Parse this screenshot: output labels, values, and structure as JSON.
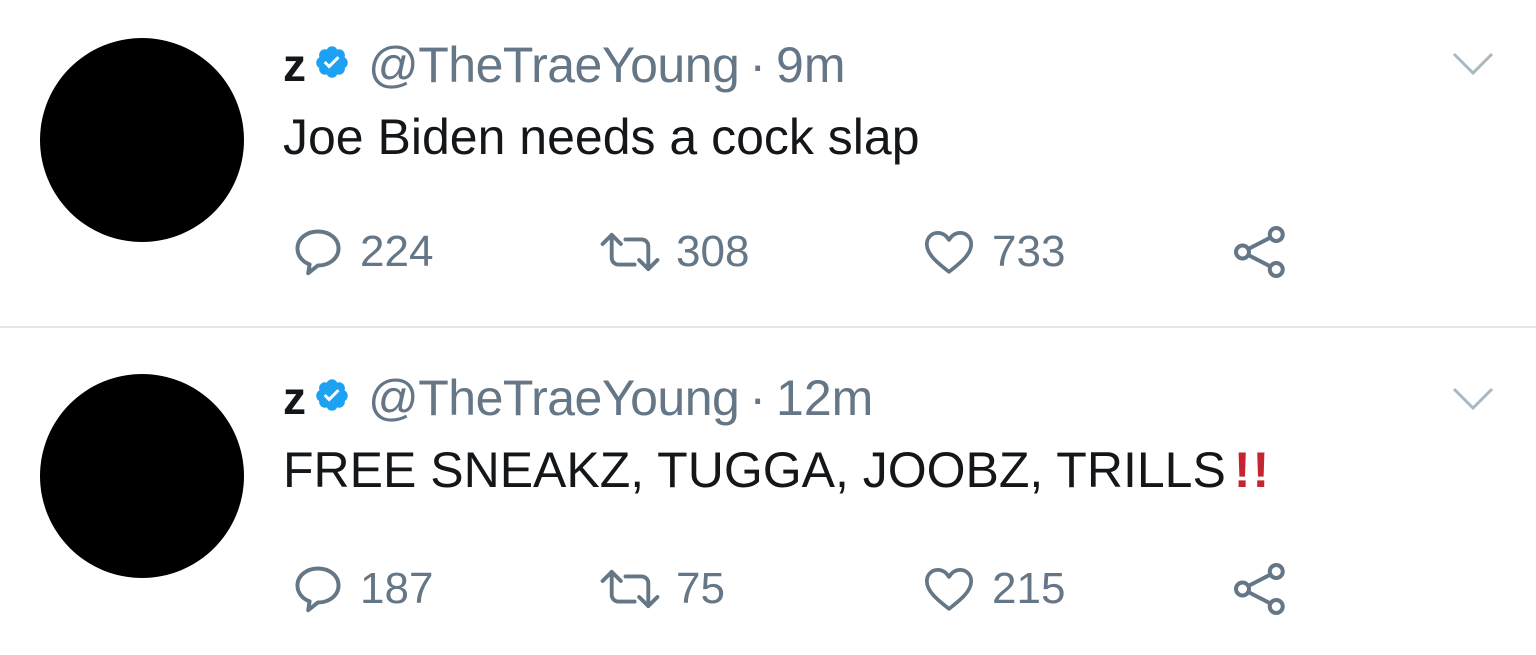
{
  "tweets": [
    {
      "name": "z",
      "handle": "@TheTraeYoung",
      "separator": "·",
      "time": "9m",
      "text": "Joe Biden needs a cock slap",
      "emphasis": "",
      "replies": "224",
      "retweets": "308",
      "likes": "733"
    },
    {
      "name": "z",
      "handle": "@TheTraeYoung",
      "separator": "·",
      "time": "12m",
      "text": "FREE SNEAKZ, TUGGA, JOOBZ, TRILLS",
      "emphasis": "!!",
      "replies": "187",
      "retweets": "75",
      "likes": "215"
    }
  ],
  "colors": {
    "verified": "#1da1f2",
    "muted": "#657786",
    "text": "#14171a",
    "divider": "#e1e8ed",
    "emphasis": "#c6252f"
  },
  "icons": [
    "verified-badge-icon",
    "chevron-down-icon",
    "reply-icon",
    "retweet-icon",
    "like-icon",
    "share-icon"
  ]
}
